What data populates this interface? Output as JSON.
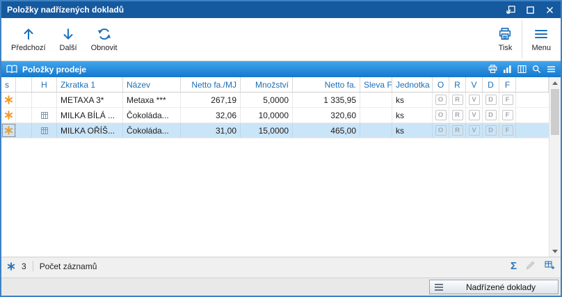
{
  "window": {
    "title": "Položky nadřízených dokladů"
  },
  "toolbar": {
    "previous": "Předchozí",
    "next": "Další",
    "refresh": "Obnovit",
    "print": "Tisk",
    "menu": "Menu"
  },
  "panel": {
    "title": "Položky prodeje"
  },
  "table": {
    "headers": {
      "s": "s",
      "h": "H",
      "zkratka": "Zkratka 1",
      "nazev": "Název",
      "netto_mj": "Netto fa./MJ",
      "mnozstvi": "Množství",
      "netto": "Netto fa.",
      "sleva": "Sleva F",
      "jednotka": "Jednotka",
      "o": "O",
      "r": "R",
      "v": "V",
      "d": "D",
      "f": "F"
    },
    "flags": {
      "o": "O",
      "r": "R",
      "v": "V",
      "d": "D",
      "f": "F"
    },
    "rows": [
      {
        "zkratka": "METAXA 3*",
        "nazev": "Metaxa ***",
        "netto_mj": "267,19",
        "mnozstvi": "5,0000",
        "netto": "1 335,95",
        "sleva": "",
        "jednotka": "ks"
      },
      {
        "zkratka": "MILKA BÍLÁ ...",
        "nazev": "Čokoláda...",
        "netto_mj": "32,06",
        "mnozstvi": "10,0000",
        "netto": "320,60",
        "sleva": "",
        "jednotka": "ks"
      },
      {
        "zkratka": "MILKA OŘÍŠ...",
        "nazev": "Čokoláda...",
        "netto_mj": "31,00",
        "mnozstvi": "15,0000",
        "netto": "465,00",
        "sleva": "",
        "jednotka": "ks"
      }
    ]
  },
  "statusbar": {
    "count": "3",
    "label": "Počet záznamů",
    "sigma": "Σ"
  },
  "bottombar": {
    "button": "Nadřízené doklady"
  },
  "colors": {
    "titlebar": "#15599F",
    "accent": "#1E6FB8",
    "panel_gradient_top": "#41A5EC",
    "panel_gradient_bottom": "#1578CE",
    "selection": "#CBE5F8",
    "asterisk_orange": "#EF9B2D",
    "asterisk_blue": "#2D74B8"
  }
}
